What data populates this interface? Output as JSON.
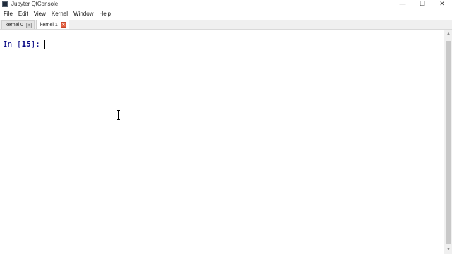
{
  "window": {
    "title": "Jupyter QtConsole",
    "controls": {
      "minimize": "—",
      "maximize": "☐",
      "close": "✕"
    }
  },
  "menu": {
    "items": [
      "File",
      "Edit",
      "View",
      "Kernel",
      "Window",
      "Help"
    ]
  },
  "tabs": [
    {
      "label": "kernel 0",
      "close": "✕",
      "active": false
    },
    {
      "label": "kernel 1",
      "close": "✕",
      "active": true
    }
  ],
  "console": {
    "prompt_prefix": "In [",
    "prompt_number": "15",
    "prompt_suffix": "]:",
    "input_value": ""
  },
  "scrollbar": {
    "up": "▲",
    "down": "▼"
  },
  "colors": {
    "prompt": "#000080",
    "active_tab_close": "#e05a3a"
  }
}
